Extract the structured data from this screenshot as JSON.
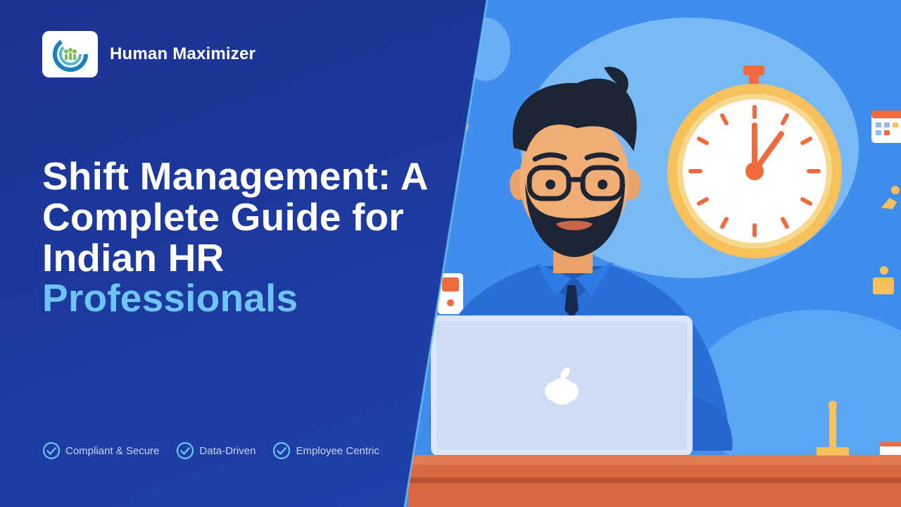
{
  "brand": {
    "name": "Human Maximizer",
    "logo_icon": "human-maximizer-logo"
  },
  "headline": {
    "line1": "Shift Management: A",
    "line2": "Complete Guide for",
    "line3": "Indian HR",
    "accent": "Professionals"
  },
  "features": [
    {
      "label": "Compliant & Secure",
      "icon": "check-circle-icon"
    },
    {
      "label": "Data-Driven",
      "icon": "check-circle-icon"
    },
    {
      "label": "Employee Centric",
      "icon": "check-circle-icon"
    }
  ],
  "colors": {
    "left_bg": "#1d3aa0",
    "right_bg": "#3f8eee",
    "accent_text": "#6ec4f2",
    "clock_ring": "#f6c15b",
    "clock_hand": "#f06a3d",
    "desk": "#d9673f"
  }
}
